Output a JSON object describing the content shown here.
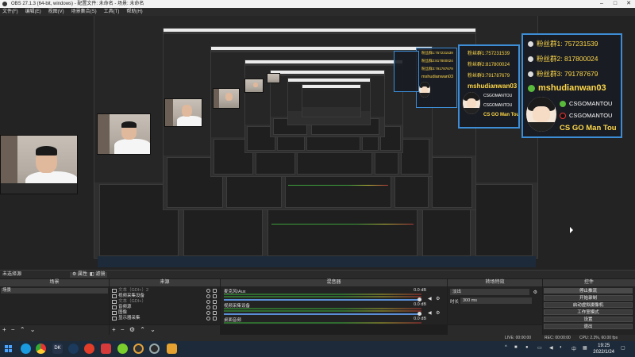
{
  "window": {
    "title": "OBS 27.1.3 (64-bit, windows) - 配置文件: 未命名 - 场景: 未命名"
  },
  "menu": [
    "文件(F)",
    "编辑(E)",
    "视图(V)",
    "场景集合(S)",
    "工具(T)",
    "帮助(H)"
  ],
  "overlay": {
    "fans1_label": "粉丝群1:",
    "fans1_value": "757231539",
    "fans2_label": "粉丝群2:",
    "fans2_value": "817800024",
    "fans3_label": "粉丝群3:",
    "fans3_value": "791787679",
    "wechat": "mshudianwan03",
    "weibo": "CSGOMANTOU",
    "douyin": "CSGOMANTOU",
    "brand": "CS GO Man Tou",
    "accent": "#3d8dd6",
    "gold": "#ffd84a"
  },
  "scene_bar": {
    "label": "未选择源",
    "properties": "属性",
    "filters": "滤镜"
  },
  "docks": {
    "scenes": {
      "title": "场景",
      "items": [
        "场景"
      ]
    },
    "sources": {
      "title": "来源",
      "items": [
        {
          "name": "文本（GDI+）2",
          "icon": "text-icon",
          "dim": true
        },
        {
          "name": "视频采集设备",
          "icon": "camera-icon",
          "dim": false
        },
        {
          "name": "文本（GDI+）",
          "icon": "text-icon",
          "dim": true
        },
        {
          "name": "音频源",
          "icon": "text-icon",
          "dim": false
        },
        {
          "name": "图像",
          "icon": "image-icon",
          "dim": false
        },
        {
          "name": "显示器采集",
          "icon": "monitor-icon",
          "dim": false
        }
      ]
    },
    "mixer": {
      "title": "混音器",
      "channels": [
        {
          "name": "麦克风/Aux",
          "db": "0.0 dB",
          "level": 0.99
        },
        {
          "name": "视频采集设备",
          "db": "0.0 dB",
          "level": 0.99
        },
        {
          "name": "桌面音频",
          "db": "0.0 dB",
          "level": 0.99
        }
      ]
    },
    "transitions": {
      "title": "转场特效",
      "mode": "淡出",
      "duration_label": "时长",
      "duration_value": "300 ms"
    },
    "controls": {
      "title": "控件",
      "buttons": [
        "停止推流",
        "开始录制",
        "启动虚拟摄像机",
        "工作室模式",
        "设置",
        "退出"
      ]
    }
  },
  "status": {
    "live": "LIVE: 00:00:00",
    "rec": "REC: 00:00:00",
    "cpu": "CPU: 2.3%, 60.00 fps"
  },
  "taskbar": {
    "time": "19:25",
    "date": "2022/1/24",
    "icons": [
      "windows-icon",
      "search-icon",
      "task-view-icon",
      "chrome-icon",
      "qq-icon",
      "steam-icon",
      "netease-icon",
      "app-icon",
      "gamepad-icon",
      "obs-icon",
      "obs-icon-2",
      "game-icon"
    ]
  }
}
